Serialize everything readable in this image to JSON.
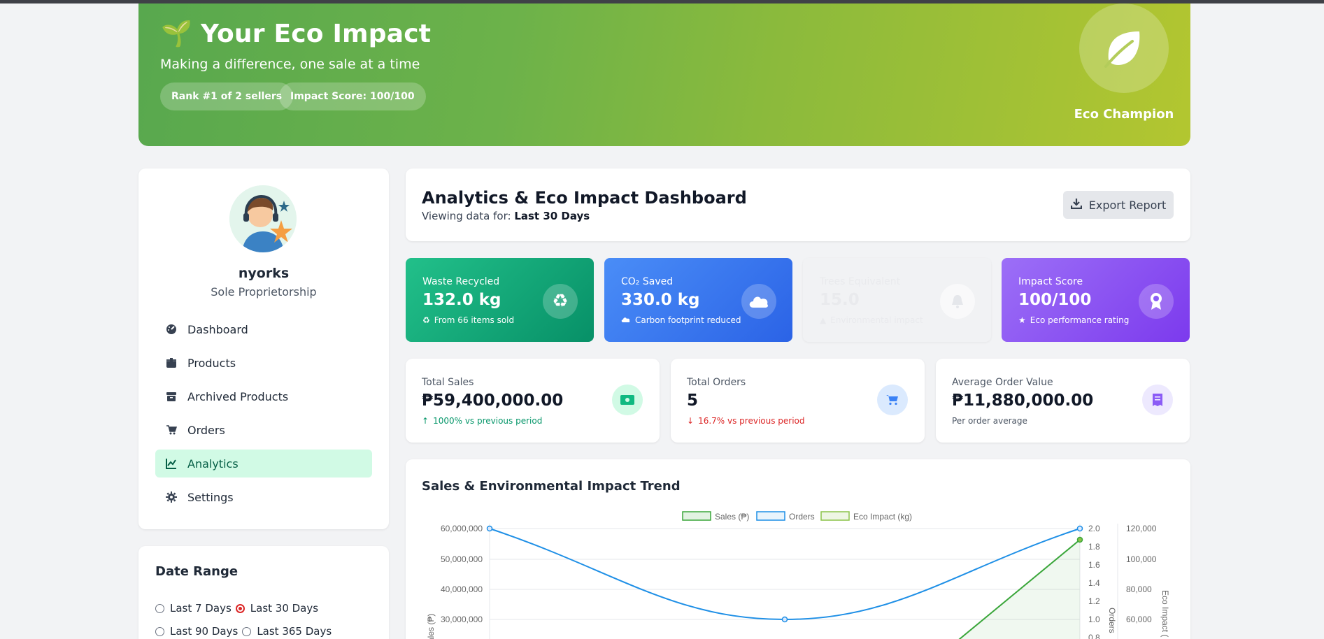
{
  "hero": {
    "emoji": "🌱",
    "title": "Your Eco Impact",
    "subtitle": "Making a difference, one sale at a time",
    "rank": "Rank #1 of 2 sellers",
    "impact_score": "Impact Score: 100/100",
    "badge_label": "Eco Champion"
  },
  "profile": {
    "name": "nyorks",
    "type": "Sole Proprietorship"
  },
  "nav": [
    {
      "label": "Dashboard",
      "icon": "gauge-icon"
    },
    {
      "label": "Products",
      "icon": "box-icon"
    },
    {
      "label": "Archived Products",
      "icon": "archive-icon"
    },
    {
      "label": "Orders",
      "icon": "cart-icon"
    },
    {
      "label": "Analytics",
      "icon": "chart-line-icon",
      "active": true
    },
    {
      "label": "Settings",
      "icon": "gear-icon"
    }
  ],
  "date_range": {
    "title": "Date Range",
    "options": [
      "Last 7 Days",
      "Last 30 Days",
      "Last 90 Days",
      "Last 365 Days"
    ],
    "selected": "Last 30 Days"
  },
  "header": {
    "title": "Analytics & Eco Impact Dashboard",
    "viewing_prefix": "Viewing data for:",
    "viewing_value": "Last 30 Days",
    "export_label": "Export Report"
  },
  "eco_cards": [
    {
      "label": "Waste Recycled",
      "value": "132.0 kg",
      "note": "From 66 items sold",
      "icon": "recycle-icon"
    },
    {
      "label": "CO₂ Saved",
      "value": "330.0 kg",
      "note": "Carbon footprint reduced",
      "icon": "cloud-icon"
    },
    {
      "label": "Trees Equivalent",
      "value": "15.0",
      "note": "Environmental impact",
      "icon": "bell-icon"
    },
    {
      "label": "Impact Score",
      "value": "100/100",
      "note": "Eco performance rating",
      "icon": "award-icon"
    }
  ],
  "stats": [
    {
      "label": "Total Sales",
      "value": "₱59,400,000.00",
      "note": "1000% vs previous period",
      "trend": "up",
      "color": "#059669"
    },
    {
      "label": "Total Orders",
      "value": "5",
      "note": "16.7% vs previous period",
      "trend": "down",
      "color": "#dc2626"
    },
    {
      "label": "Average Order Value",
      "value": "₱11,880,000.00",
      "note": "Per order average",
      "trend": "none",
      "color": "#4b5563"
    }
  ],
  "chart_title": "Sales & Environmental Impact Trend",
  "chart_data": {
    "type": "line",
    "legend": [
      "Sales (₱)",
      "Orders",
      "Eco Impact (kg)"
    ],
    "series": [
      {
        "name": "Sales (₱)",
        "color": "#3aa63a",
        "axis": "y-left"
      },
      {
        "name": "Orders",
        "color": "#1e8fe6",
        "axis": "y-right-1",
        "values": [
          2.0,
          1.0,
          2.0
        ]
      },
      {
        "name": "Eco Impact (kg)",
        "color": "#8bc34a",
        "axis": "y-right-2"
      }
    ],
    "y_left_label": "Sales (₱)",
    "y_left_ticks": [
      "60,000,000",
      "50,000,000",
      "40,000,000",
      "30,000,000"
    ],
    "y_right1_label": "Orders",
    "y_right1_ticks": [
      "2.0",
      "1.8",
      "1.6",
      "1.4",
      "1.2",
      "1.0",
      "0.8"
    ],
    "y_right2_label": "Eco Impact (",
    "y_right2_ticks": [
      "120,000",
      "100,000",
      "80,000",
      "60,000"
    ]
  },
  "colors": {
    "accent_green": "#10b981",
    "active_nav_bg": "#d1fae5"
  }
}
